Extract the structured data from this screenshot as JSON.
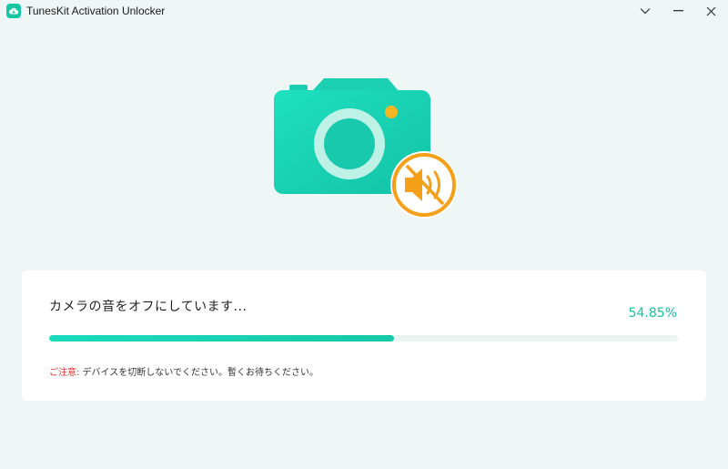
{
  "window": {
    "title": "TunesKit Activation Unlocker",
    "logo_icon": "cloud-icon",
    "controls": {
      "menu_icon": "chevron-down-icon",
      "minimize_icon": "minimize-icon",
      "close_icon": "close-icon"
    }
  },
  "hero": {
    "camera_icon": "camera-icon",
    "badge_icon": "speaker-muted-icon"
  },
  "progress": {
    "status": "カメラの音をオフにしています...",
    "percent_label": "54.85%",
    "percent_value": 54.85,
    "notice_label": "ご注意:",
    "notice_text": " デバイスを切断しないでください。暫くお待ちください。"
  },
  "colors": {
    "accent": "#16c2a2",
    "camera": "#1bd0b2",
    "badge": "#f5a019",
    "warning": "#e8302f",
    "background": "#eef7f5"
  }
}
